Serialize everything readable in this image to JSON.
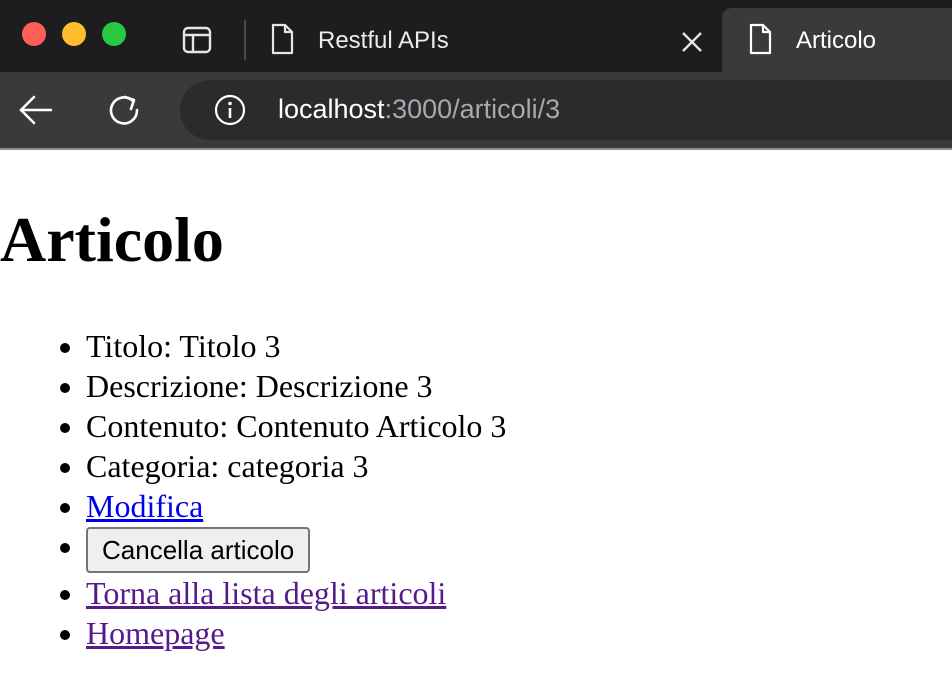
{
  "browser": {
    "tabs": [
      {
        "label": "Restful APIs",
        "active": false
      },
      {
        "label": "Articolo",
        "active": true
      }
    ],
    "url": {
      "host": "localhost",
      "path": ":3000/articoli/3"
    }
  },
  "page": {
    "title": "Articolo",
    "fields": [
      {
        "text": "Titolo: Titolo 3"
      },
      {
        "text": "Descrizione: Descrizione 3"
      },
      {
        "text": "Contenuto: Contenuto Articolo 3"
      },
      {
        "text": "Categoria: categoria 3"
      }
    ],
    "edit_link": "Modifica",
    "delete_button": "Cancella articolo",
    "back_link": "Torna alla lista degli articoli",
    "home_link": "Homepage"
  },
  "colors": {
    "link": "#0000ee",
    "visited_link": "#551a8b",
    "tabbar_bg": "#1d1d1f",
    "toolbar_bg": "#3a3a3c"
  },
  "icons": [
    "sidebar-icon",
    "document-icon",
    "close-icon",
    "back-arrow-icon",
    "reload-icon",
    "info-icon"
  ]
}
